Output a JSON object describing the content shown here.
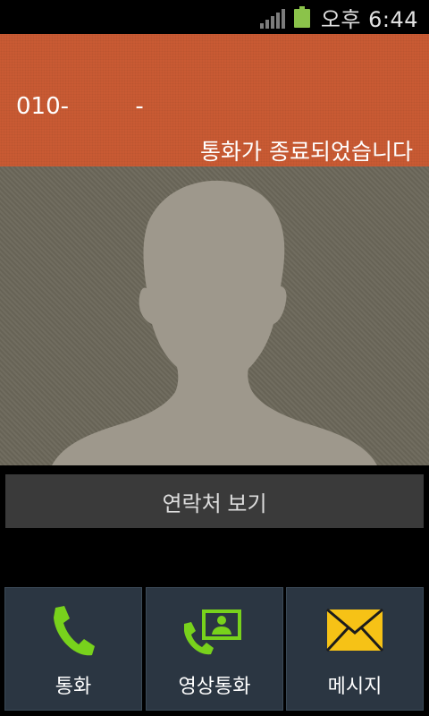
{
  "status_bar": {
    "time": "오후 6:44",
    "icons": [
      "signal-icon",
      "battery-icon"
    ],
    "battery_color": "#8bc34a"
  },
  "call": {
    "number": "010-         -",
    "status": "통화가 종료되었습니다",
    "header_color": "#c95a33"
  },
  "contact": {
    "avatar_icon": "person-silhouette-icon",
    "view_contact_label": "연락처 보기"
  },
  "actions": {
    "call_label": "통화",
    "video_call_label": "영상통화",
    "message_label": "메시지",
    "call_icon": "phone-icon",
    "video_call_icon": "video-call-icon",
    "message_icon": "envelope-icon",
    "icon_green": "#78d21c",
    "message_yellow": "#f6c216"
  }
}
